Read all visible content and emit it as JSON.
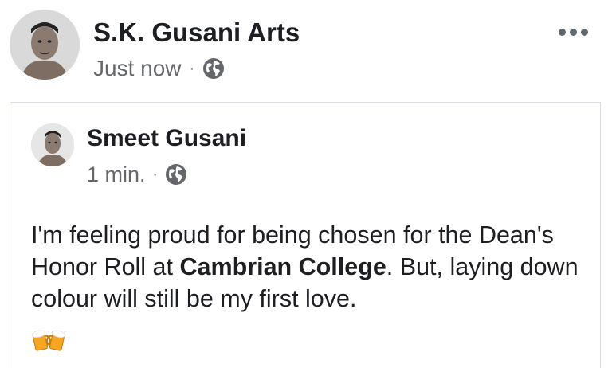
{
  "post": {
    "author": "S.K. Gusani Arts",
    "time": "Just now",
    "separator": "·",
    "privacy_icon": "globe-icon",
    "more_icon": "more-horizontal-icon"
  },
  "shared_post": {
    "author": "Smeet Gusani",
    "time": "1 min.",
    "separator": "·",
    "privacy_icon": "globe-icon",
    "text_part1": "I'm feeling proud for being chosen for the Dean's Honor Roll at ",
    "text_bold": "Cambrian College",
    "text_part2": ". But, laying down colour will still be my first love.",
    "emoji_icon": "beer-mugs-icon"
  },
  "colors": {
    "text_primary": "#1c1e21",
    "text_secondary": "#65676b",
    "border": "#dadde1"
  }
}
